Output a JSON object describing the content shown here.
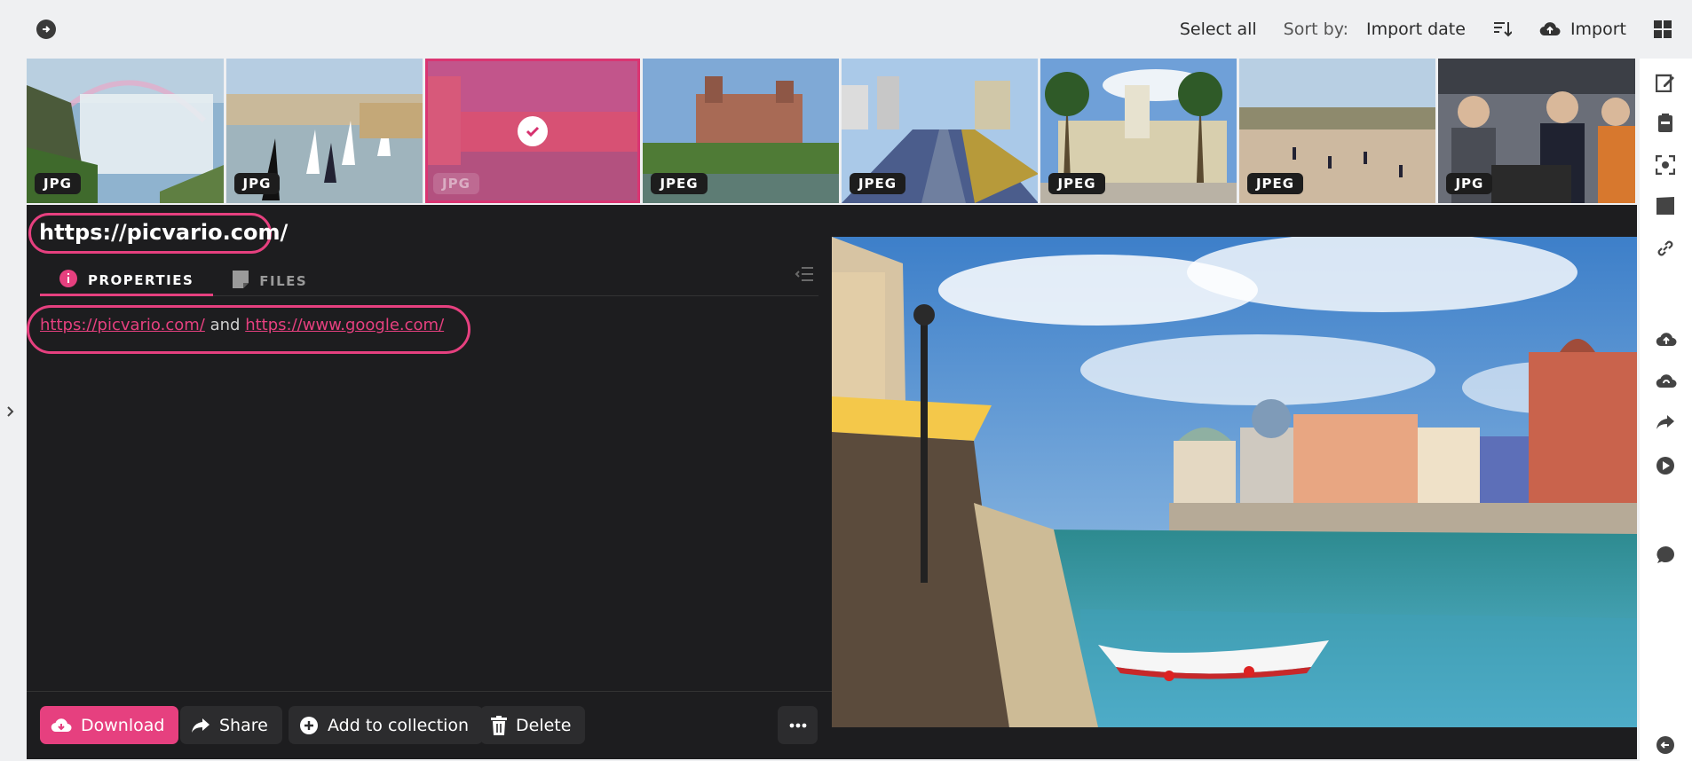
{
  "toolbar": {
    "select_all": "Select all",
    "sort_label": "Sort by:",
    "sort_value": "Import date",
    "import": "Import"
  },
  "thumbnails": [
    {
      "format": "JPG",
      "scene": "waterfall with rainbow",
      "selected": false
    },
    {
      "format": "JPG",
      "scene": "harbor with sailboats",
      "selected": false
    },
    {
      "format": "JPG",
      "scene": "canal town",
      "selected": true
    },
    {
      "format": "JPEG",
      "scene": "castle by river",
      "selected": false
    },
    {
      "format": "JPEG",
      "scene": "rail yard with trains",
      "selected": false
    },
    {
      "format": "JPEG",
      "scene": "clock tower with palms",
      "selected": false
    },
    {
      "format": "JPEG",
      "scene": "dirt field with people",
      "selected": false
    },
    {
      "format": "JPG",
      "scene": "people at workbench",
      "selected": false
    }
  ],
  "detail": {
    "title": "https://picvario.com/",
    "tabs": [
      "PROPERTIES",
      "FILES"
    ],
    "links": {
      "first": "https://picvario.com/",
      "joiner": "and",
      "second": "https://www.google.com/"
    }
  },
  "actions": {
    "download": "Download",
    "share": "Share",
    "add": "Add to collection",
    "delete": "Delete"
  },
  "colors": {
    "accent": "#e6407f",
    "panel": "#1d1d1f"
  },
  "icons": {
    "rail": [
      "edit-icon",
      "clipboard-icon",
      "face-scan-icon",
      "film-icon",
      "link-icon",
      "cloud-upload-icon",
      "cloud-sync-icon",
      "share-icon",
      "play-icon",
      "comment-icon",
      "back-icon"
    ]
  }
}
